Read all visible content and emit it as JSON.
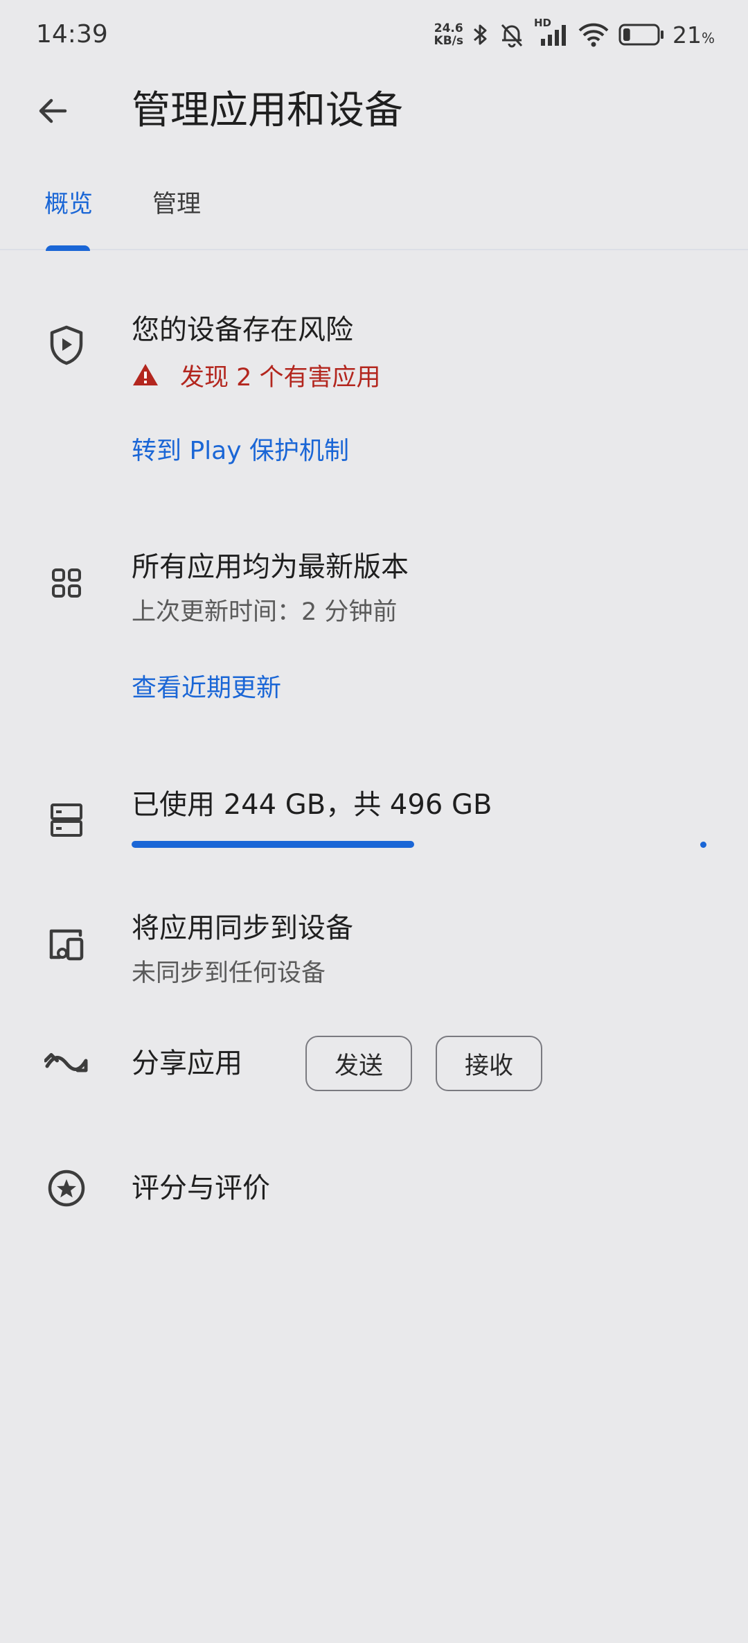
{
  "status_bar": {
    "time": "14:39",
    "speed_value": "24.6",
    "speed_unit": "KB/s",
    "network_label": "HD",
    "battery_percent": "21",
    "battery_suffix": "%",
    "battery_level": 0.21
  },
  "header": {
    "title": "管理应用和设备"
  },
  "tabs": [
    {
      "label": "概览",
      "active": true
    },
    {
      "label": "管理",
      "active": false
    }
  ],
  "protection": {
    "title": "您的设备存在风险",
    "warning": "发现 2 个有害应用",
    "link": "转到 Play 保护机制"
  },
  "updates": {
    "title": "所有应用均为最新版本",
    "subtitle": "上次更新时间：2 分钟前",
    "link": "查看近期更新"
  },
  "storage": {
    "title": "已使用 244 GB，共 496 GB",
    "used_gb": 244,
    "total_gb": 496
  },
  "sync": {
    "title": "将应用同步到设备",
    "subtitle": "未同步到任何设备"
  },
  "share": {
    "title": "分享应用",
    "send_label": "发送",
    "receive_label": "接收"
  },
  "ratings": {
    "title": "评分与评价"
  },
  "colors": {
    "accent": "#1a66d6",
    "warning": "#b3261e",
    "background": "#e9e9eb"
  },
  "icons": {
    "back": "arrow-back-icon",
    "protection": "play-protect-shield-icon",
    "warning": "warning-triangle-icon",
    "updates": "apps-grid-icon",
    "storage": "storage-icon",
    "sync": "devices-icon",
    "share": "share-apps-icon",
    "ratings": "star-circle-icon"
  }
}
